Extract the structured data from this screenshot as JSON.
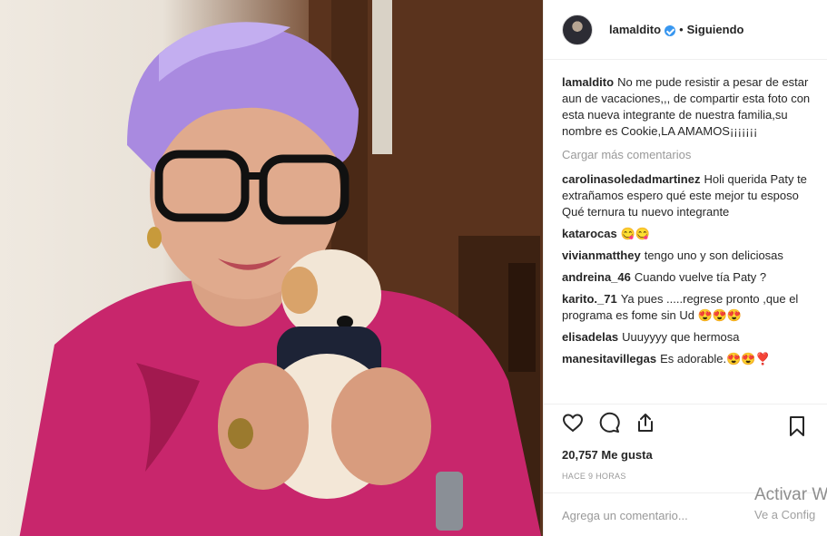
{
  "post": {
    "username": "lamaldito",
    "separator": "•",
    "follow_status": "Siguiendo"
  },
  "caption": {
    "username": "lamaldito",
    "text": "No me pude resistir a pesar de estar aun de vacaciones,,, de compartir esta foto con esta nueva integrante de nuestra familia,su nombre es Cookie,LA AMAMOS¡¡¡¡¡¡¡"
  },
  "load_more_label": "Cargar más comentarios",
  "comments": [
    {
      "user": "carolinasoledadmartinez",
      "text": "Holi querida Paty te extrañamos espero qué este mejor tu esposo",
      "text2": "Qué ternura tu nuevo integrante"
    },
    {
      "user": "katarocas",
      "text": "😋😋"
    },
    {
      "user": "vivianmatthey",
      "text": "tengo uno y son deliciosas"
    },
    {
      "user": "andreina_46",
      "text": "Cuando vuelve tía Paty ?"
    },
    {
      "user": "karito._71",
      "text": "Ya pues .....regrese pronto ,que el programa es fome sin Ud 😍😍😍"
    },
    {
      "user": "elisadelas",
      "text": "Uuuyyyy que hermosa"
    },
    {
      "user": "manesitavillegas",
      "text": "Es adorable.😍😍❣️"
    }
  ],
  "icons": [
    "heart-icon",
    "comment-icon",
    "share-icon",
    "bookmark-icon",
    "verified-icon"
  ],
  "likes": "20,757 Me gusta",
  "timestamp": "HACE 9 HORAS",
  "add_comment_placeholder": "Agrega un comentario...",
  "watermark": {
    "line1": "Activar W",
    "line2": "Ve a Config"
  },
  "colors": {
    "verified": "#3897f0",
    "muted": "#999999",
    "text": "#262626",
    "hair": "#a98ae0",
    "shirt": "#c8266c"
  }
}
